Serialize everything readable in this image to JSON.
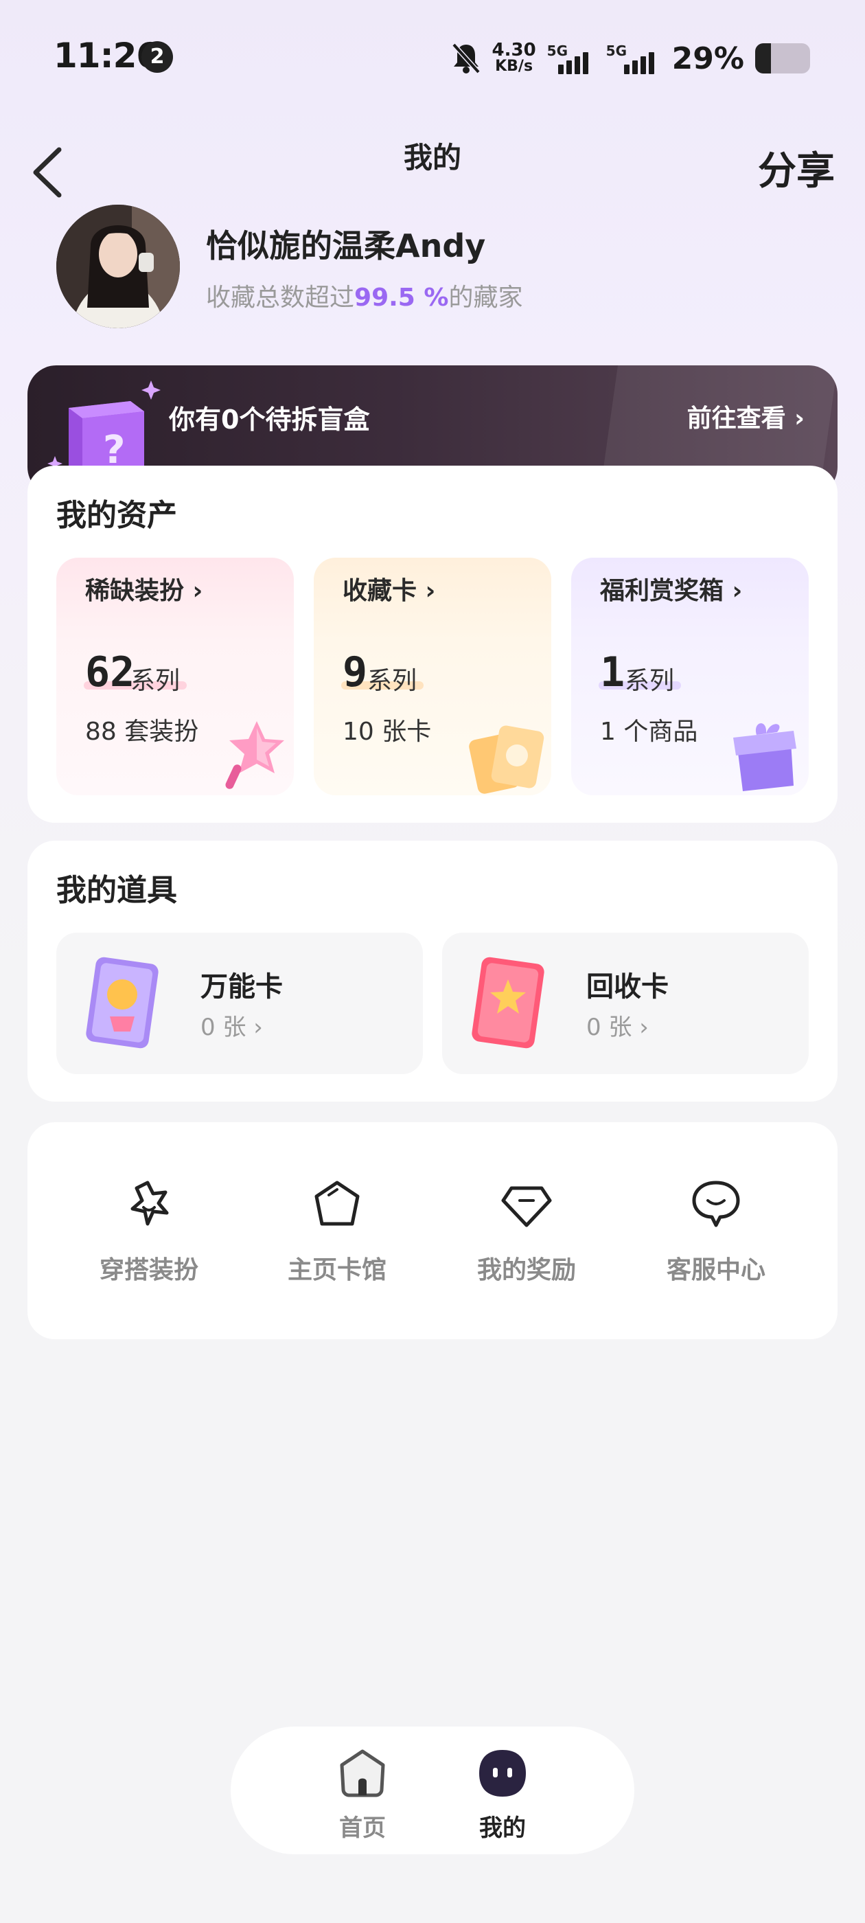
{
  "status_bar": {
    "time": "11:26",
    "notification_count": "2",
    "net_speed_value": "4.30",
    "net_speed_unit": "KB/s",
    "signal1_label": "5G",
    "signal2_label": "5G",
    "battery_percent": "29%",
    "battery_level": 0.29
  },
  "header": {
    "title": "我的",
    "share_label": "分享"
  },
  "profile": {
    "username": "恰似旎的温柔Andy",
    "subtitle_prefix": "收藏总数超过",
    "subtitle_highlight": "99.5 %",
    "subtitle_suffix": "的藏家"
  },
  "blind_box": {
    "text": "你有0个待拆盲盒",
    "link": "前往查看 ›"
  },
  "assets": {
    "title": "我的资产",
    "items": [
      {
        "label": "稀缺装扮 ›",
        "value": "62",
        "unit": "系列",
        "desc": "88 套装扮"
      },
      {
        "label": "收藏卡 ›",
        "value": "9",
        "unit": "系列",
        "desc": "10 张卡"
      },
      {
        "label": "福利赏奖箱 ›",
        "value": "1",
        "unit": "系列",
        "desc": "1 个商品"
      }
    ]
  },
  "props": {
    "title": "我的道具",
    "items": [
      {
        "name": "万能卡",
        "count": "0 张 ›"
      },
      {
        "name": "回收卡",
        "count": "0 张 ›"
      }
    ]
  },
  "menu": {
    "items": [
      {
        "label": "穿搭装扮",
        "icon": "star-hanger-icon"
      },
      {
        "label": "主页卡馆",
        "icon": "pentagon-icon"
      },
      {
        "label": "我的奖励",
        "icon": "diamond-icon"
      },
      {
        "label": "客服中心",
        "icon": "chat-bubble-icon"
      }
    ]
  },
  "bottom_nav": {
    "items": [
      {
        "label": "首页",
        "icon": "home-icon",
        "active": false
      },
      {
        "label": "我的",
        "icon": "face-icon",
        "active": true
      }
    ]
  },
  "colors": {
    "accent_purple": "#9a68f2",
    "banner_dark": "#2b1f2a",
    "muted_text": "#9a9a9a"
  }
}
